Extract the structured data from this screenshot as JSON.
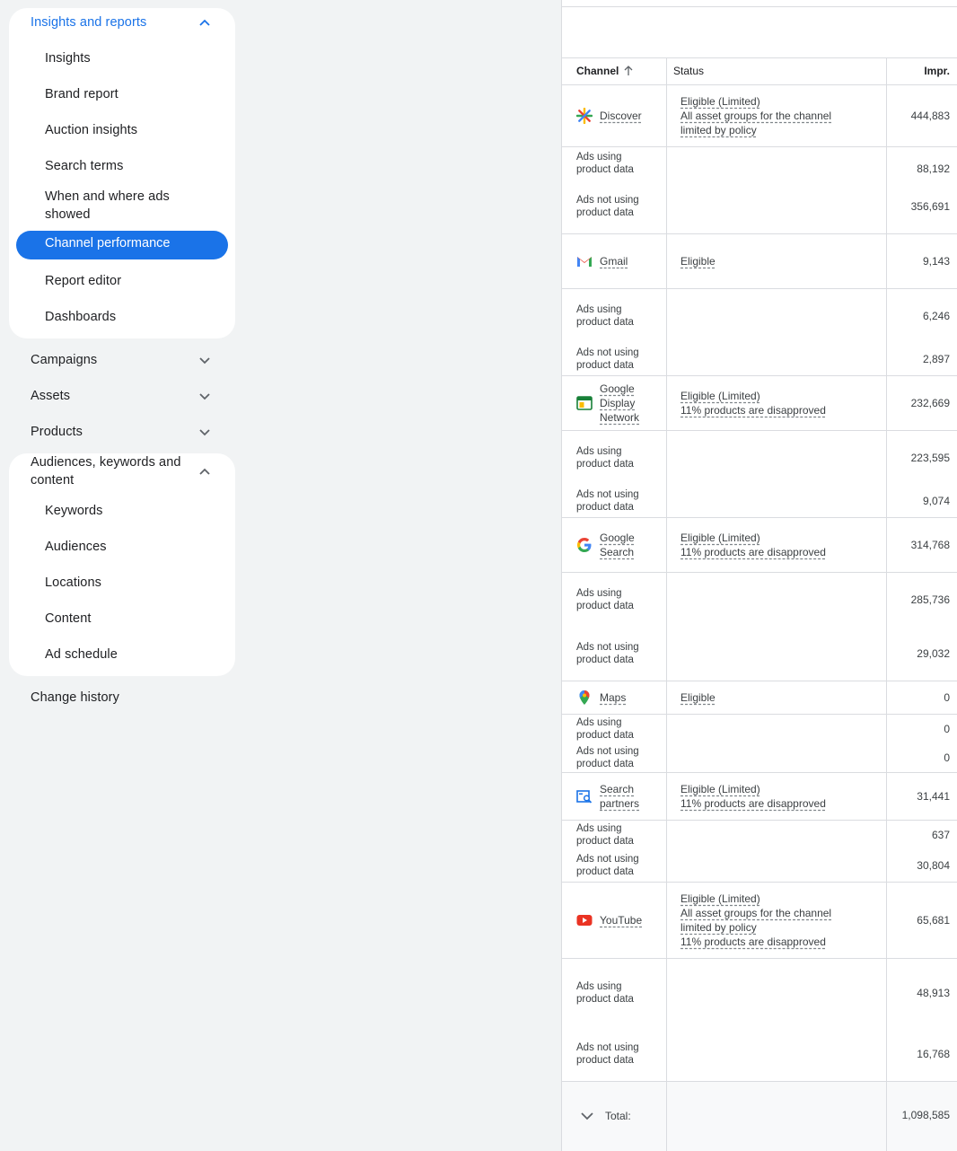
{
  "sidebar": {
    "insights_group": {
      "title": "Insights and reports",
      "items": [
        "Insights",
        "Brand report",
        "Auction insights",
        "Search terms",
        "When and where ads showed",
        "Channel performance",
        "Report editor",
        "Dashboards"
      ]
    },
    "campaigns": "Campaigns",
    "assets": "Assets",
    "products": "Products",
    "audiences_group": {
      "title": "Audiences, keywords and content",
      "items": [
        "Keywords",
        "Audiences",
        "Locations",
        "Content",
        "Ad schedule"
      ]
    },
    "change_history": "Change history"
  },
  "table": {
    "headers": {
      "channel": "Channel",
      "status": "Status",
      "impr": "Impr."
    },
    "rows": [
      {
        "channel": "Discover",
        "status": [
          "Eligible (Limited)",
          "All asset groups for the channel limited by policy"
        ],
        "impr": "444,883",
        "using": "88,192",
        "not_using": "356,691"
      },
      {
        "channel": "Gmail",
        "status": [
          "Eligible"
        ],
        "impr": "9,143",
        "using": "6,246",
        "not_using": "2,897"
      },
      {
        "channel": "Google Display Network",
        "status": [
          "Eligible (Limited)",
          "11% products are disapproved"
        ],
        "impr": "232,669",
        "using": "223,595",
        "not_using": "9,074"
      },
      {
        "channel": "Google Search",
        "status": [
          "Eligible (Limited)",
          "11% products are disapproved"
        ],
        "impr": "314,768",
        "using": "285,736",
        "not_using": "29,032"
      },
      {
        "channel": "Maps",
        "status": [
          "Eligible"
        ],
        "impr": "0",
        "using": "0",
        "not_using": "0"
      },
      {
        "channel": "Search partners",
        "status": [
          "Eligible (Limited)",
          "11% products are disapproved"
        ],
        "impr": "31,441",
        "using": "637",
        "not_using": "30,804"
      },
      {
        "channel": "YouTube",
        "status": [
          "Eligible (Limited)",
          "All asset groups for the channel limited by policy",
          "11% products are disapproved"
        ],
        "impr": "65,681",
        "using": "48,913",
        "not_using": "16,768"
      }
    ],
    "sub_labels": {
      "using": "Ads using product data",
      "not_using": "Ads not using product data"
    },
    "total": {
      "label": "Total:",
      "impr": "1,098,585"
    }
  }
}
